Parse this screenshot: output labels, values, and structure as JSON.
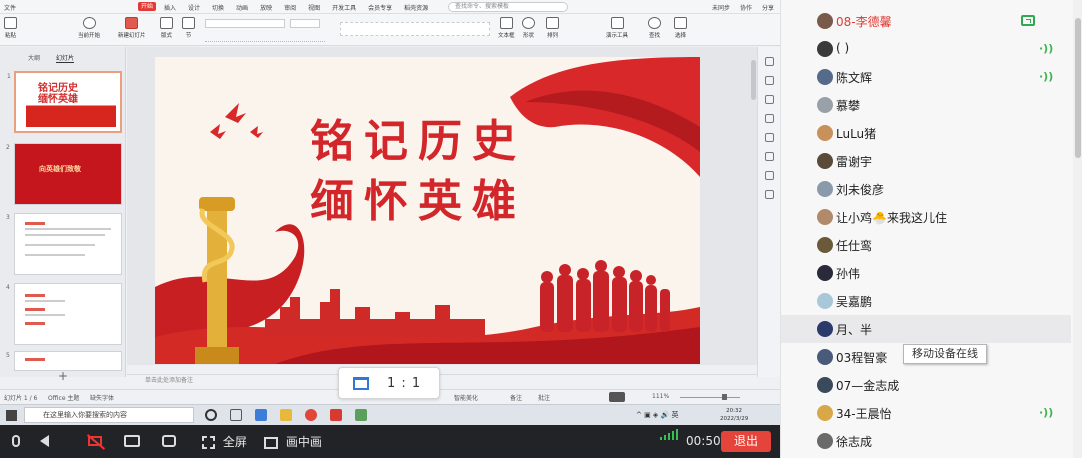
{
  "app": {
    "menu_items": [
      "文件",
      "开始",
      "插入",
      "设计",
      "切换",
      "动画",
      "放映",
      "审阅",
      "视图",
      "开发工具",
      "会员专享",
      "稻壳资源"
    ],
    "search_placeholder": "查找命令、搜索模板",
    "right_actions": [
      "未同步",
      "协作",
      "分享"
    ],
    "toolbar_labels": [
      "粘贴",
      "当前开始",
      "新建幻灯片",
      "版式",
      "节",
      "文本框",
      "形状",
      "排列",
      "演示工具",
      "查找",
      "选择"
    ]
  },
  "thumbnails": {
    "tabs": [
      "大纲",
      "幻灯片"
    ],
    "numbers": [
      "1",
      "2",
      "3",
      "4",
      "5"
    ],
    "thumb1_text": "铭记历史\n缅怀英雄",
    "thumb2_text": "向英雄们致敬"
  },
  "slide": {
    "line1": "铭记历史",
    "line2": "缅怀英雄"
  },
  "notes_placeholder": "单击此处添加备注",
  "status": {
    "page": "幻灯片 1 / 6",
    "theme": "Office 主题",
    "font": "缺失字体",
    "beautify": "智能美化",
    "notes": "备注",
    "comments": "批注",
    "zoom": "111%"
  },
  "zoom_popup": {
    "ratio": "1 : 1"
  },
  "taskbar": {
    "search_placeholder": "在这里输入你要搜索的内容",
    "time": "20:32",
    "date": "2022/3/29"
  },
  "participants": [
    {
      "name": "08-李德馨",
      "host": true,
      "icon": "share-screen-icon",
      "avatar": "#7a5a4a"
    },
    {
      "name": "(      )",
      "icon": "mic-active-icon",
      "avatar": "#3a3a3a"
    },
    {
      "name": "陈文辉",
      "icon": "mic-active-icon",
      "avatar": "#556b8a"
    },
    {
      "name": "慕攀",
      "avatar": "#9aa0a8"
    },
    {
      "name": "LuLu猪",
      "avatar": "#c8905a"
    },
    {
      "name": "雷谢宇",
      "avatar": "#5a4a3a"
    },
    {
      "name": "刘未俊彦",
      "avatar": "#8a9aaa"
    },
    {
      "name": "让小鸡🐣来我这儿住",
      "avatar": "#b08a6a"
    },
    {
      "name": "任仕鸾",
      "avatar": "#6a5a3a"
    },
    {
      "name": "孙伟",
      "avatar": "#2a2a3a"
    },
    {
      "name": "吴嘉鹏",
      "avatar": "#a8c8d8"
    },
    {
      "name": "月、半",
      "avatar": "#2a3a6a",
      "highlighted": true
    },
    {
      "name": "03程智豪",
      "avatar": "#4a5a7a"
    },
    {
      "name": "07—金志成",
      "avatar": "#3a4a5a"
    },
    {
      "name": "34-王晨怡",
      "icon": "mic-active-icon",
      "avatar": "#d8a848"
    },
    {
      "name": "徐志成",
      "avatar": "#6a6a6a"
    }
  ],
  "tooltip": "移动设备在线",
  "controls": {
    "fullscreen": "全屏",
    "pip": "画中画",
    "timer": "00:50",
    "exit": "退出"
  },
  "colors": {
    "exit": "#e5443b",
    "host_name": "#e23b32",
    "mic_active": "#3fb34f",
    "slide_title": "#d2262a"
  }
}
